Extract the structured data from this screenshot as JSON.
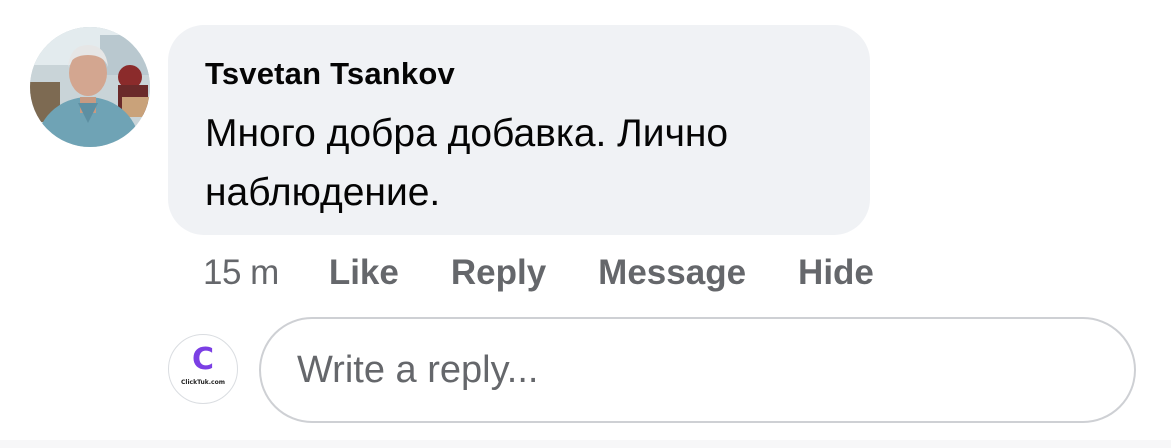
{
  "comment": {
    "author": "Tsvetan Tsankov",
    "text": "Много добра добавка. Лично наблюдение.",
    "avatar_icon": "user-photo-avatar"
  },
  "actions": {
    "time": "15 m",
    "like": "Like",
    "reply": "Reply",
    "message": "Message",
    "hide": "Hide"
  },
  "reply": {
    "placeholder": "Write a reply...",
    "value": "",
    "avatar_letter": "C",
    "avatar_brand": "ClickTuk.com"
  },
  "colors": {
    "bubble_bg": "#f0f2f5",
    "secondary_text": "#65676b",
    "primary_text": "#050505",
    "brand_accent": "#7b3fe4"
  }
}
